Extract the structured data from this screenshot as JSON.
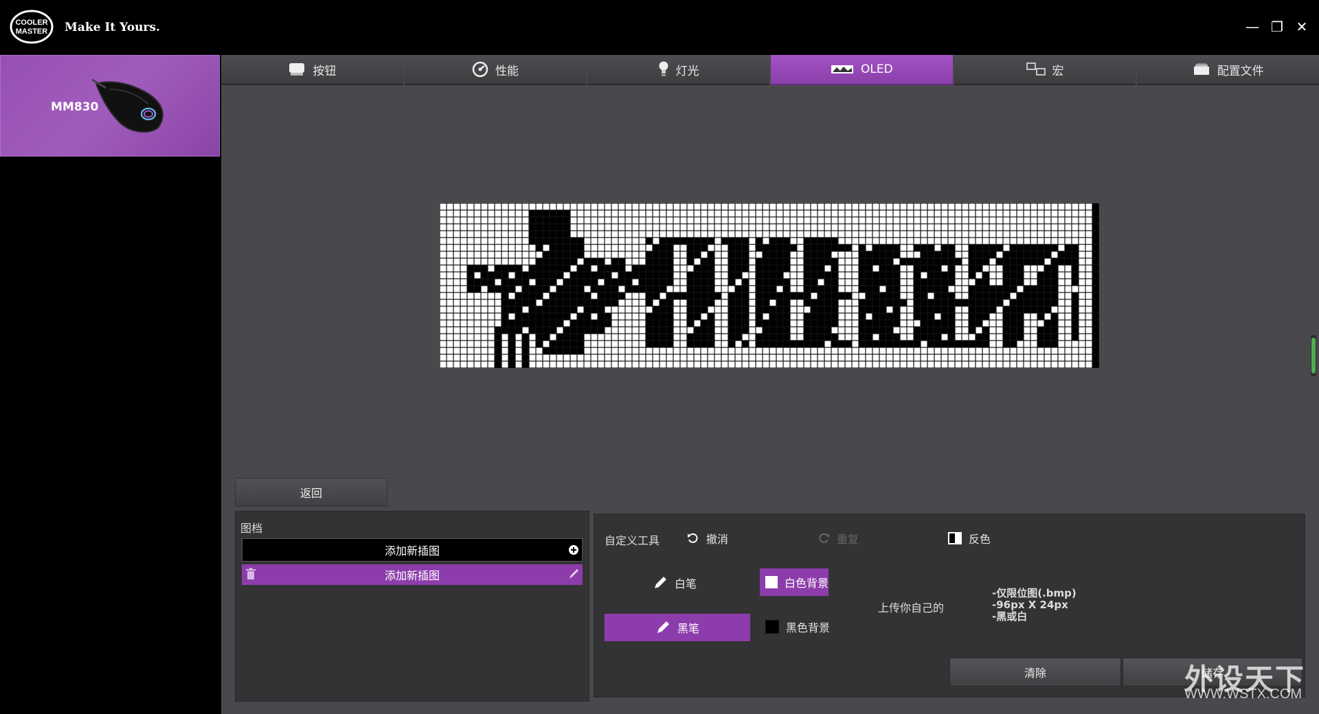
{
  "header": {
    "brand_logo_text": "COOLER MASTER",
    "tagline": "Make It Yours.",
    "window_controls": {
      "minimize": "—",
      "restore": "❐",
      "close": "✕"
    }
  },
  "device": {
    "name": "MM830",
    "image_icon": "mouse-image"
  },
  "tabs": [
    {
      "label": "按钮",
      "icon": "button-icon",
      "active": false
    },
    {
      "label": "性能",
      "icon": "gauge-icon",
      "active": false
    },
    {
      "label": "灯光",
      "icon": "bulb-icon",
      "active": false
    },
    {
      "label": "OLED",
      "icon": "oled-icon",
      "active": true
    },
    {
      "label": "宏",
      "icon": "macro-icon",
      "active": false
    },
    {
      "label": "配置文件",
      "icon": "profile-icon",
      "active": false
    }
  ],
  "oled": {
    "columns": 96,
    "rows": 24,
    "pixel_colors": {
      "on": "#000000",
      "off": "#ffffff"
    }
  },
  "back_label": "返回",
  "image_panel": {
    "title": "图档",
    "add_label": "添加新插图",
    "items": [
      {
        "label": "添加新插图",
        "selected": true
      }
    ]
  },
  "tools": {
    "custom_tools_label": "自定义工具",
    "undo_label": "撤消",
    "redo_label": "重复",
    "invert_label": "反色",
    "white_pen_label": "白笔",
    "black_pen_label": "黑笔",
    "white_bg_label": "白色背景",
    "black_bg_label": "黑色背景",
    "upload_label": "上传你自己的",
    "upload_notes": [
      "-仅限位图(.bmp)",
      "-96px X 24px",
      "-黑或白"
    ],
    "clear_label": "清除",
    "save_label": "储存"
  },
  "watermark": {
    "text": "外设天下",
    "url": "WWW.WSTX.COM"
  },
  "colors": {
    "accent": "#8d3dab",
    "panel": "#333335",
    "background": "#49494d"
  }
}
